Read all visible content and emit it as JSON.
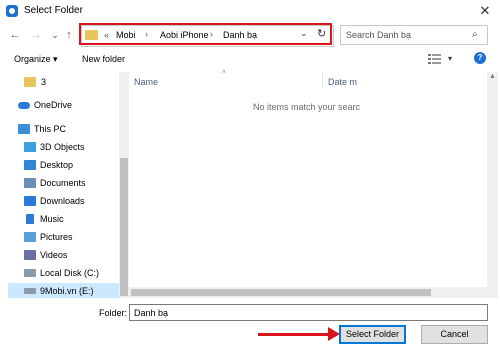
{
  "window": {
    "title": "Select Folder",
    "close_glyph": "✕"
  },
  "nav": {
    "back_glyph": "←",
    "forward_glyph": "→",
    "history_glyph": "⌄",
    "up_glyph": "↑",
    "address": {
      "overflow": "«",
      "crumbs": [
        "Mobi",
        "Aobi iPhone",
        "Danh bạ"
      ],
      "dropdown_glyph": "⌄",
      "refresh_glyph": "↻"
    },
    "search": {
      "placeholder": "Search Danh bạ",
      "icon_glyph": "⌕"
    }
  },
  "toolbar": {
    "organize_label": "Organize ▾",
    "new_folder_label": "New folder",
    "help_glyph": "?"
  },
  "sidebar": {
    "items": [
      {
        "label": "3",
        "icon": "folder-icon",
        "color": "#e8c55a"
      },
      {
        "label": "OneDrive",
        "icon": "cloud-icon",
        "color": "#2a7ad8"
      },
      {
        "label": "This PC",
        "icon": "computer-icon",
        "color": "#3a8fd8"
      },
      {
        "label": "3D Objects",
        "icon": "cube-icon",
        "color": "#3aa0e0"
      },
      {
        "label": "Desktop",
        "icon": "desktop-icon",
        "color": "#2f86d6"
      },
      {
        "label": "Documents",
        "icon": "documents-icon",
        "color": "#6b8fb8"
      },
      {
        "label": "Downloads",
        "icon": "downloads-icon",
        "color": "#2a7ad8"
      },
      {
        "label": "Music",
        "icon": "music-icon",
        "color": "#2a7ad8"
      },
      {
        "label": "Pictures",
        "icon": "pictures-icon",
        "color": "#5aa0d8"
      },
      {
        "label": "Videos",
        "icon": "videos-icon",
        "color": "#6a6fa8"
      },
      {
        "label": "Local Disk (C:)",
        "icon": "disk-icon",
        "color": "#8a9aaa"
      },
      {
        "label": "9Mobi.vn (E:)",
        "icon": "drive-icon",
        "color": "#8a9aaa"
      }
    ]
  },
  "content": {
    "columns": {
      "name": "Name",
      "date": "Date m"
    },
    "empty_message": "No items match your searc"
  },
  "footer": {
    "folder_label": "Folder:",
    "folder_value": "Danh bạ",
    "select_label": "Select Folder",
    "cancel_label": "Cancel"
  },
  "colors": {
    "accent": "#0078d7",
    "annotation": "#d8141c",
    "selection": "#cce8ff"
  }
}
